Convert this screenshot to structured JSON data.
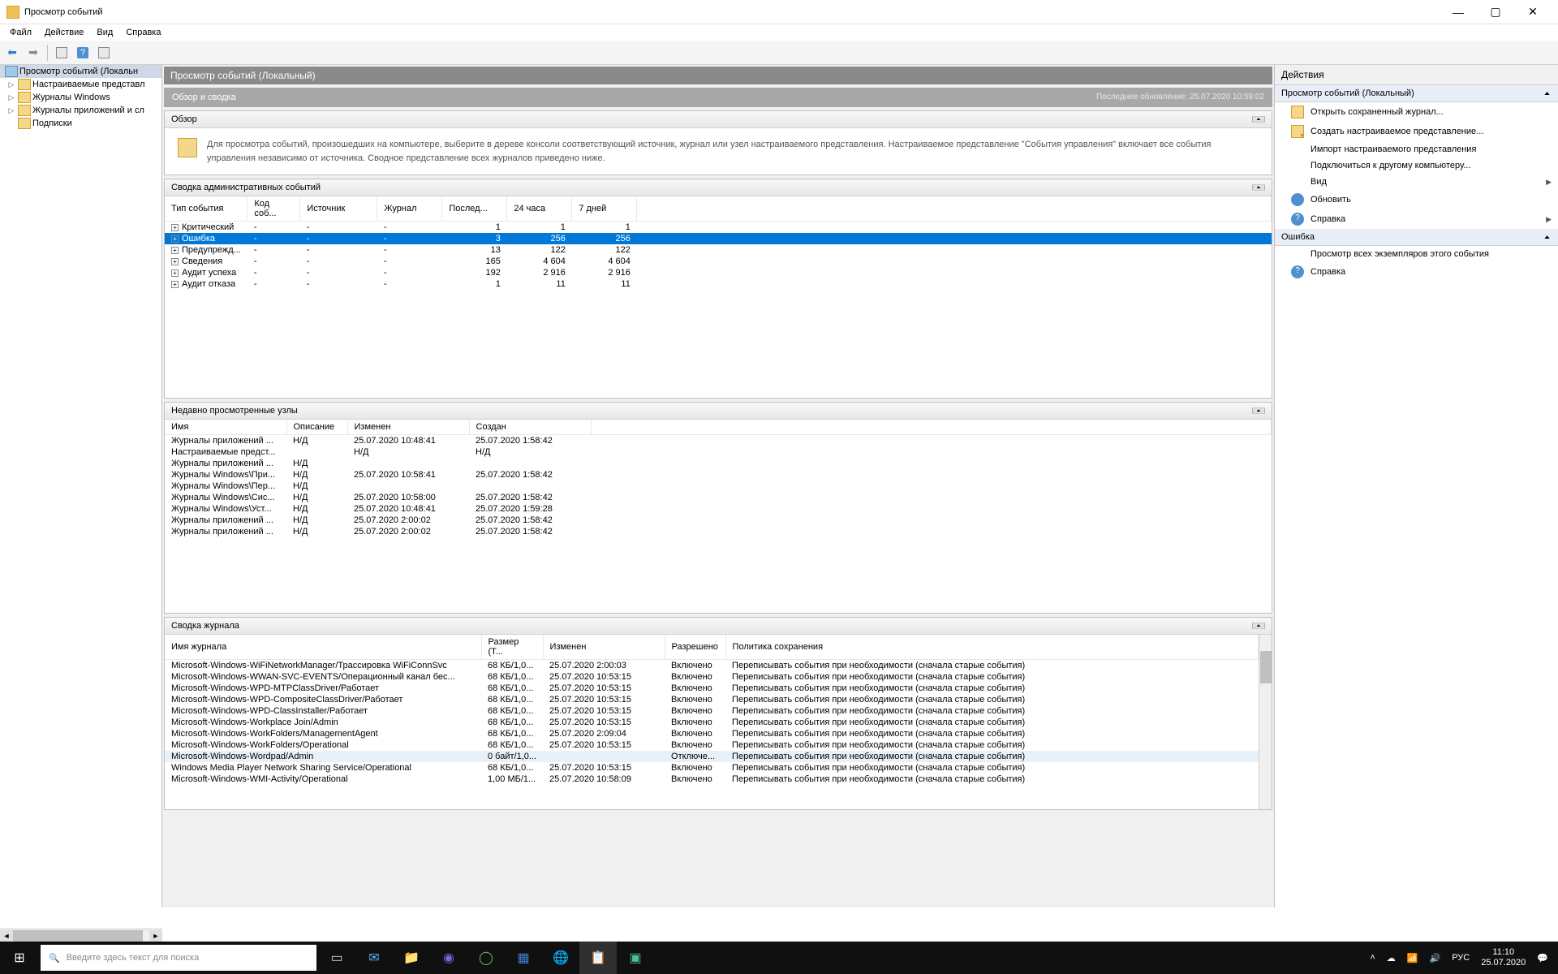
{
  "window": {
    "title": "Просмотр событий",
    "min": "—",
    "max": "▢",
    "close": "✕"
  },
  "menubar": [
    "Файл",
    "Действие",
    "Вид",
    "Справка"
  ],
  "toolbar": {
    "back": "⬅",
    "fwd": "➡"
  },
  "tree": {
    "root": "Просмотр событий (Локальн",
    "items": [
      "Настраиваемые представл",
      "Журналы Windows",
      "Журналы приложений и сл",
      "Подписки"
    ]
  },
  "content": {
    "header": "Просмотр событий (Локальный)",
    "subheader": "Обзор и сводка",
    "last_update": "Последнее обновление: 25.07.2020 10:59:02",
    "overview": {
      "title": "Обзор",
      "text": "Для просмотра событий, произошедших на компьютере, выберите в дереве консоли соответствующий источник, журнал или узел настраиваемого представления. Настраиваемое представление \"События управления\" включает все события управления независимо от источника. Сводное представление всех журналов приведено ниже."
    },
    "summary": {
      "title": "Сводка административных событий",
      "headers": [
        "Тип события",
        "Код соб...",
        "Источник",
        "Журнал",
        "Послед...",
        "24 часа",
        "7 дней"
      ],
      "rows": [
        {
          "type": "Критический",
          "code": "-",
          "src": "-",
          "log": "-",
          "last": "1",
          "h24": "1",
          "d7": "1",
          "sel": false
        },
        {
          "type": "Ошибка",
          "code": "-",
          "src": "-",
          "log": "-",
          "last": "3",
          "h24": "256",
          "d7": "256",
          "sel": true
        },
        {
          "type": "Предупрежд...",
          "code": "-",
          "src": "-",
          "log": "-",
          "last": "13",
          "h24": "122",
          "d7": "122",
          "sel": false
        },
        {
          "type": "Сведения",
          "code": "-",
          "src": "-",
          "log": "-",
          "last": "165",
          "h24": "4 604",
          "d7": "4 604",
          "sel": false
        },
        {
          "type": "Аудит успеха",
          "code": "-",
          "src": "-",
          "log": "-",
          "last": "192",
          "h24": "2 916",
          "d7": "2 916",
          "sel": false
        },
        {
          "type": "Аудит отказа",
          "code": "-",
          "src": "-",
          "log": "-",
          "last": "1",
          "h24": "11",
          "d7": "11",
          "sel": false
        }
      ]
    },
    "recent": {
      "title": "Недавно просмотренные узлы",
      "headers": [
        "Имя",
        "Описание",
        "Изменен",
        "Создан"
      ],
      "rows": [
        {
          "name": "Журналы приложений ...",
          "desc": "Н/Д",
          "mod": "25.07.2020 10:48:41",
          "cre": "25.07.2020 1:58:42"
        },
        {
          "name": "Настраиваемые предст...",
          "desc": "",
          "mod": "Н/Д",
          "cre": "Н/Д"
        },
        {
          "name": "Журналы приложений ...",
          "desc": "Н/Д",
          "mod": "",
          "cre": ""
        },
        {
          "name": "Журналы Windows\\При...",
          "desc": "Н/Д",
          "mod": "25.07.2020 10:58:41",
          "cre": "25.07.2020 1:58:42"
        },
        {
          "name": "Журналы Windows\\Пер...",
          "desc": "Н/Д",
          "mod": "",
          "cre": ""
        },
        {
          "name": "Журналы Windows\\Сис...",
          "desc": "Н/Д",
          "mod": "25.07.2020 10:58:00",
          "cre": "25.07.2020 1:58:42"
        },
        {
          "name": "Журналы Windows\\Уст...",
          "desc": "Н/Д",
          "mod": "25.07.2020 10:48:41",
          "cre": "25.07.2020 1:59:28"
        },
        {
          "name": "Журналы приложений ...",
          "desc": "Н/Д",
          "mod": "25.07.2020 2:00:02",
          "cre": "25.07.2020 1:58:42"
        },
        {
          "name": "Журналы приложений ...",
          "desc": "Н/Д",
          "mod": "25.07.2020 2:00:02",
          "cre": "25.07.2020 1:58:42"
        }
      ]
    },
    "logs": {
      "title": "Сводка журнала",
      "headers": [
        "Имя журнала",
        "Размер (Т...",
        "Изменен",
        "Разрешено",
        "Политика сохранения"
      ],
      "rows": [
        {
          "name": "Microsoft-Windows-WiFiNetworkManager/Трассировка WiFiConnSvc",
          "size": "68 КБ/1,0...",
          "mod": "25.07.2020 2:00:03",
          "en": "Включено",
          "pol": "Переписывать события при необходимости (сначала старые события)",
          "hl": false
        },
        {
          "name": "Microsoft-Windows-WWAN-SVC-EVENTS/Операционный канал бес...",
          "size": "68 КБ/1,0...",
          "mod": "25.07.2020 10:53:15",
          "en": "Включено",
          "pol": "Переписывать события при необходимости (сначала старые события)",
          "hl": false
        },
        {
          "name": "Microsoft-Windows-WPD-MTPClassDriver/Работает",
          "size": "68 КБ/1,0...",
          "mod": "25.07.2020 10:53:15",
          "en": "Включено",
          "pol": "Переписывать события при необходимости (сначала старые события)",
          "hl": false
        },
        {
          "name": "Microsoft-Windows-WPD-CompositeClassDriver/Работает",
          "size": "68 КБ/1,0...",
          "mod": "25.07.2020 10:53:15",
          "en": "Включено",
          "pol": "Переписывать события при необходимости (сначала старые события)",
          "hl": false
        },
        {
          "name": "Microsoft-Windows-WPD-ClassInstaller/Работает",
          "size": "68 КБ/1,0...",
          "mod": "25.07.2020 10:53:15",
          "en": "Включено",
          "pol": "Переписывать события при необходимости (сначала старые события)",
          "hl": false
        },
        {
          "name": "Microsoft-Windows-Workplace Join/Admin",
          "size": "68 КБ/1,0...",
          "mod": "25.07.2020 10:53:15",
          "en": "Включено",
          "pol": "Переписывать события при необходимости (сначала старые события)",
          "hl": false
        },
        {
          "name": "Microsoft-Windows-WorkFolders/ManagementAgent",
          "size": "68 КБ/1,0...",
          "mod": "25.07.2020 2:09:04",
          "en": "Включено",
          "pol": "Переписывать события при необходимости (сначала старые события)",
          "hl": false
        },
        {
          "name": "Microsoft-Windows-WorkFolders/Operational",
          "size": "68 КБ/1,0...",
          "mod": "25.07.2020 10:53:15",
          "en": "Включено",
          "pol": "Переписывать события при необходимости (сначала старые события)",
          "hl": false
        },
        {
          "name": "Microsoft-Windows-Wordpad/Admin",
          "size": "0 байт/1,0...",
          "mod": "",
          "en": "Отключе...",
          "pol": "Переписывать события при необходимости (сначала старые события)",
          "hl": true
        },
        {
          "name": "Windows Media Player Network Sharing Service/Operational",
          "size": "68 КБ/1,0...",
          "mod": "25.07.2020 10:53:15",
          "en": "Включено",
          "pol": "Переписывать события при необходимости (сначала старые события)",
          "hl": false
        },
        {
          "name": "Microsoft-Windows-WMI-Activity/Operational",
          "size": "1,00 МБ/1...",
          "mod": "25.07.2020 10:58:09",
          "en": "Включено",
          "pol": "Переписывать события при необходимости (сначала старые события)",
          "hl": false
        }
      ]
    }
  },
  "actions": {
    "title": "Действия",
    "group1": "Просмотр событий (Локальный)",
    "items1": [
      {
        "icon": "open",
        "label": "Открыть сохраненный журнал..."
      },
      {
        "icon": "create",
        "label": "Создать настраиваемое представление..."
      },
      {
        "icon": "",
        "label": "Импорт настраиваемого представления"
      },
      {
        "icon": "",
        "label": "Подключиться к другому компьютеру..."
      },
      {
        "icon": "",
        "label": "Вид",
        "arrow": true
      },
      {
        "icon": "refresh",
        "label": "Обновить"
      },
      {
        "icon": "help",
        "label": "Справка",
        "arrow": true
      }
    ],
    "group2": "Ошибка",
    "items2": [
      {
        "icon": "",
        "label": "Просмотр всех экземпляров этого события"
      },
      {
        "icon": "help",
        "label": "Справка"
      }
    ]
  },
  "taskbar": {
    "search_placeholder": "Введите здесь текст для поиска",
    "lang": "РУС",
    "time": "11:10",
    "date": "25.07.2020"
  }
}
